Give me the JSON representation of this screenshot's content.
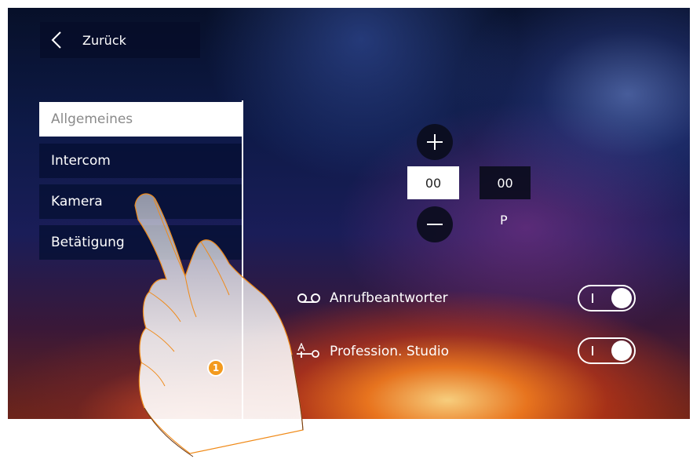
{
  "header": {
    "back_label": "Zurück"
  },
  "sidebar": {
    "items": [
      {
        "label": "Allgemeines",
        "active": true
      },
      {
        "label": "Intercom",
        "active": false
      },
      {
        "label": "Kamera",
        "active": false
      },
      {
        "label": "Betätigung",
        "active": false
      }
    ]
  },
  "time_setting": {
    "increase_icon": "plus-icon",
    "decrease_icon": "minus-icon",
    "value_selected": "00",
    "value_other": "00",
    "label": "P"
  },
  "options": [
    {
      "label": "Anrufbeantworter",
      "icon": "voicemail-icon",
      "enabled": true
    },
    {
      "label": "Profession. Studio",
      "icon": "professional-studio-icon",
      "enabled": true
    }
  ],
  "annotation": {
    "step_number": "1"
  },
  "colors": {
    "panel_dark": "#06103a",
    "accent_orange": "#f39a1e",
    "active_item_bg": "#ffffff",
    "active_item_text": "#8a8a8a"
  }
}
